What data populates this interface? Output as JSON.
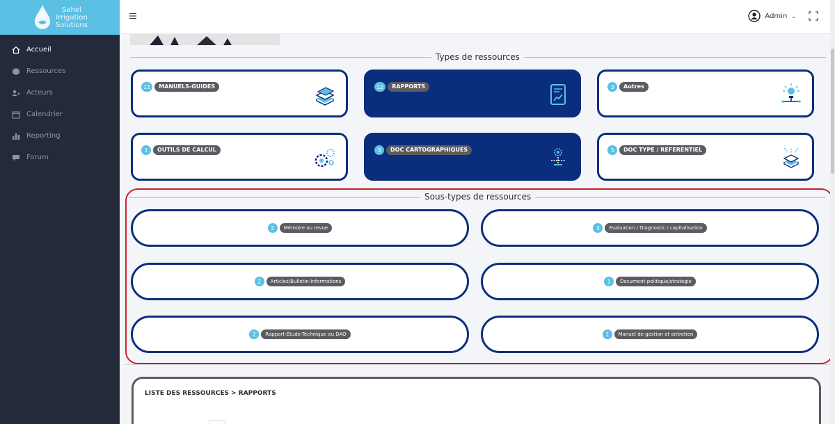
{
  "brand": {
    "line1": "Sahel",
    "line2": "Irrigation",
    "line3": "Solutions"
  },
  "sidebar": {
    "items": [
      {
        "label": "Accueil",
        "icon": "home-icon",
        "active": true
      },
      {
        "label": "Ressources",
        "icon": "cube-icon"
      },
      {
        "label": "Acteurs",
        "icon": "users-icon"
      },
      {
        "label": "Calendrier",
        "icon": "calendar-icon"
      },
      {
        "label": "Reporting",
        "icon": "bar-chart-icon"
      },
      {
        "label": "Forum",
        "icon": "chat-icon"
      }
    ]
  },
  "topbar": {
    "user_name": "Admin",
    "user_chevron": "⌄"
  },
  "types_section": {
    "title": "Types de ressources"
  },
  "types": [
    {
      "count": "11",
      "label": "MANUELS-GUIDES",
      "icon": "books-icon",
      "dark": false
    },
    {
      "count": "12",
      "label": "RAPPORTS",
      "icon": "report-chart-icon",
      "dark": true
    },
    {
      "count": "3",
      "label": "Autres",
      "icon": "bulb-network-icon",
      "dark": false
    },
    {
      "count": "1",
      "label": "OUTILS DE CALCUL",
      "icon": "gears-icon",
      "dark": false
    },
    {
      "count": "3",
      "label": "DOC CARTOGRAPHIQUES",
      "icon": "map-network-icon",
      "dark": true
    },
    {
      "count": "3",
      "label": "DOC TYPE / REFERENTIEL",
      "icon": "stack-network-icon",
      "dark": false
    }
  ],
  "subtypes_section": {
    "title": "Sous-types de ressources"
  },
  "subtypes": [
    {
      "count": "2",
      "label": "Mémoire ou revue"
    },
    {
      "count": "3",
      "label": "Evaluation / Diagnostic / capitalisation"
    },
    {
      "count": "2",
      "label": "Articles/Bulletin-Informations"
    },
    {
      "count": "1",
      "label": "Document-politique/stratégie"
    },
    {
      "count": "2",
      "label": "Rapport-Etude-Technique ou DAO"
    },
    {
      "count": "1",
      "label": "Manuel de gestion et entretien"
    }
  ],
  "list_panel": {
    "title": "LISTE DES RESSOURCES > RAPPORTS"
  },
  "colors": {
    "accent": "#5bc0e4",
    "navy": "#0b2d7d",
    "sidebar": "#252a3a",
    "highlight": "#cc1f2a"
  }
}
